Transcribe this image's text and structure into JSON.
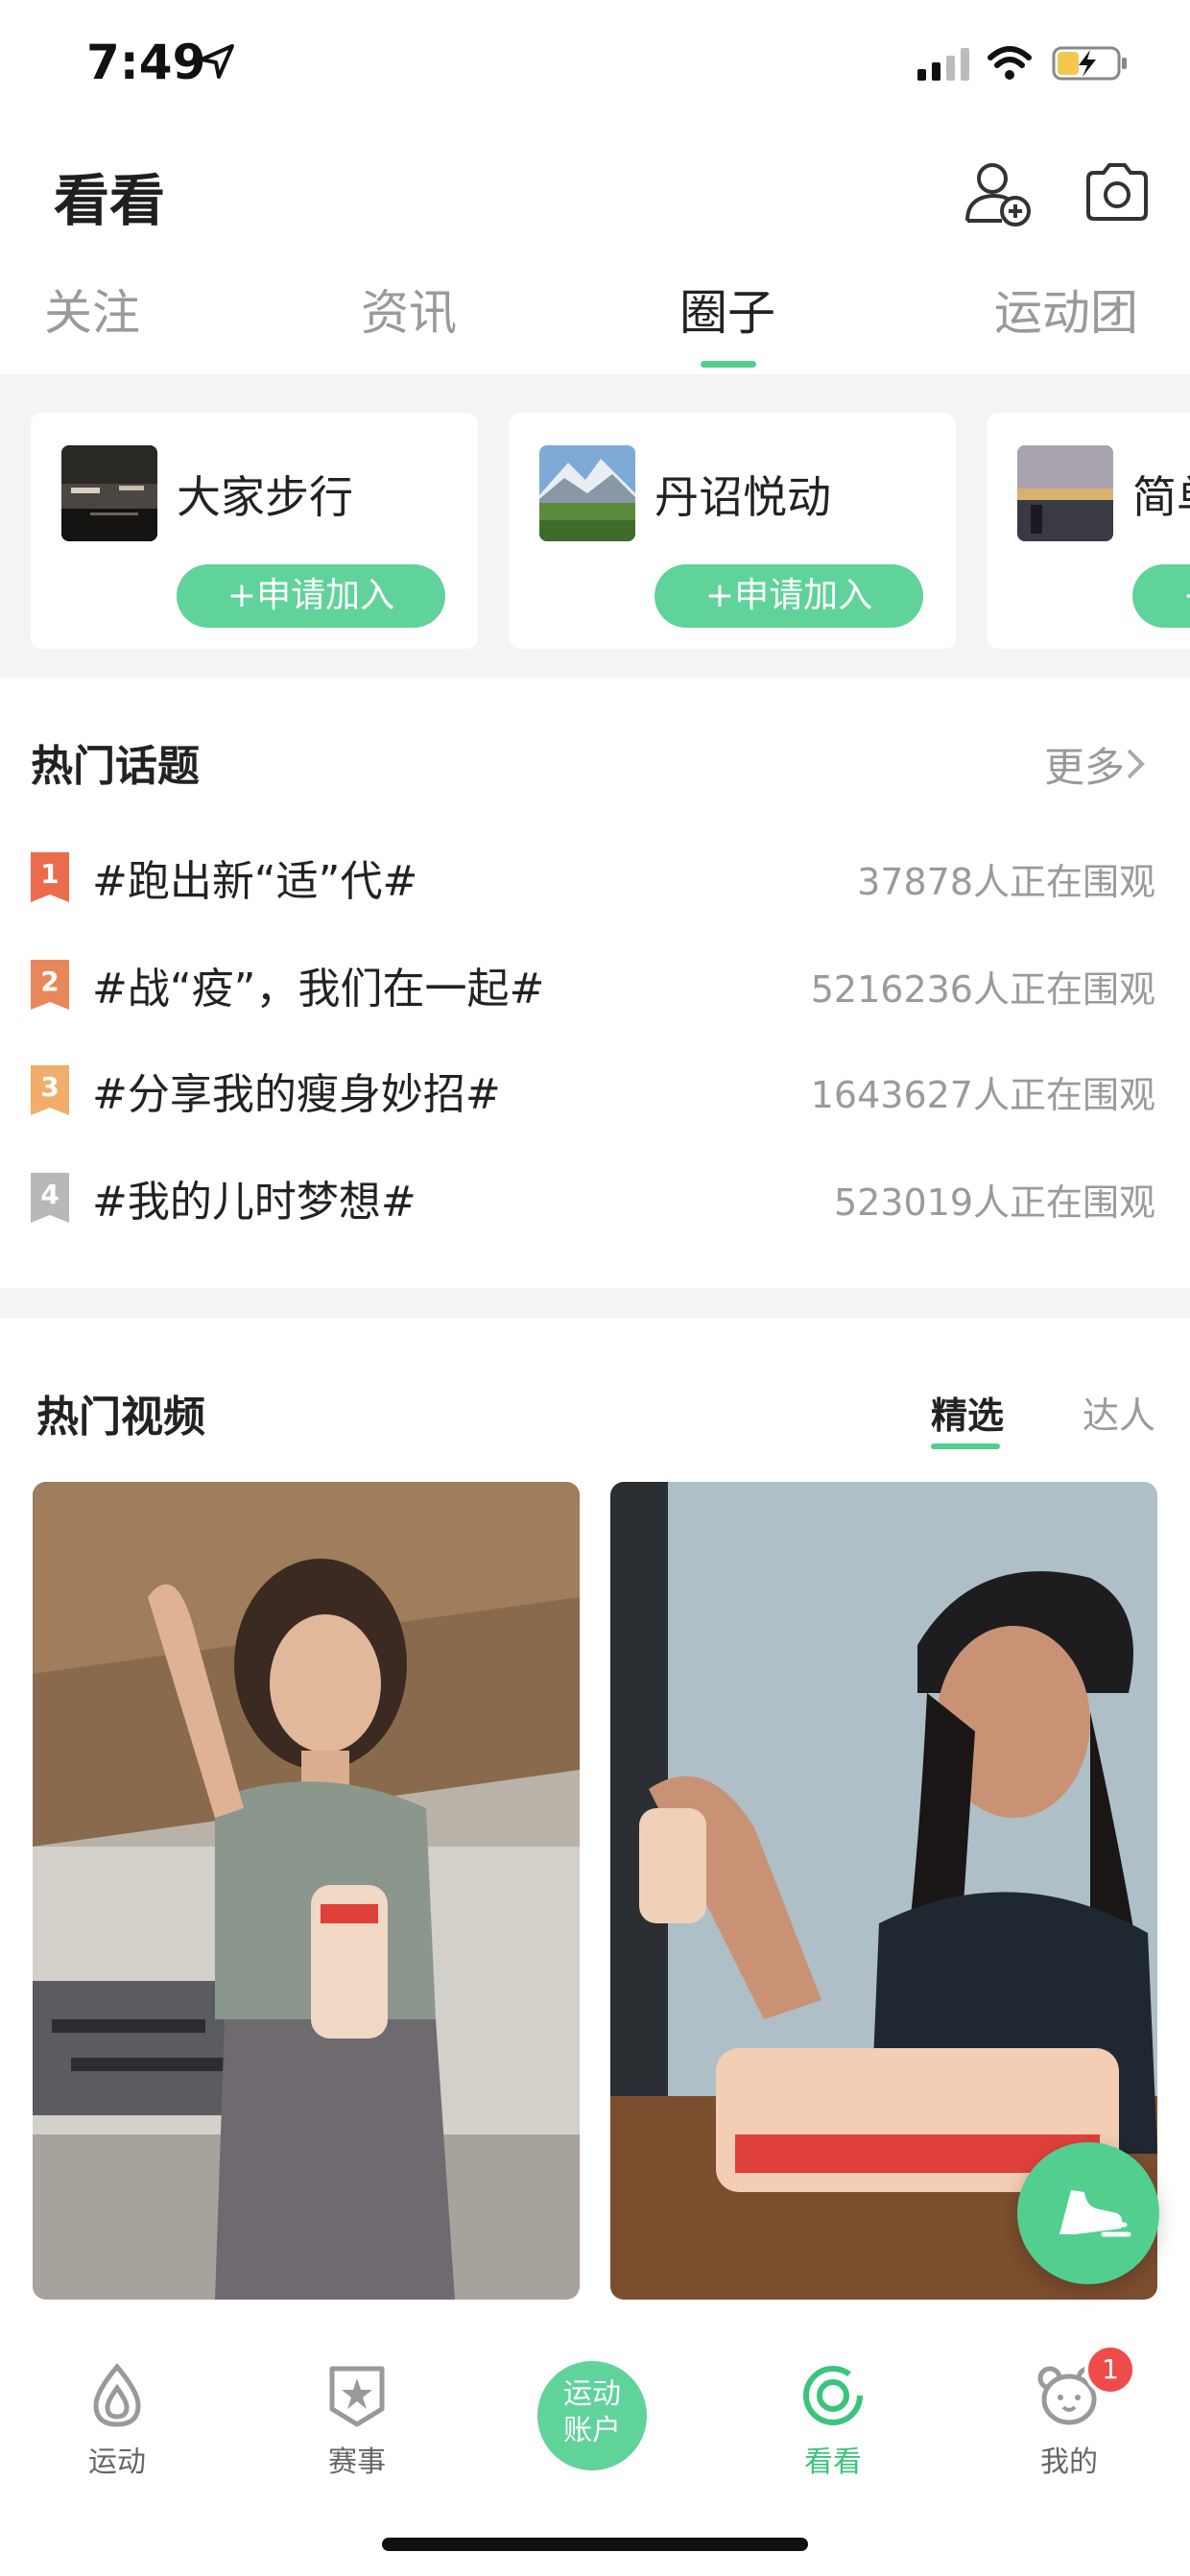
{
  "status_bar": {
    "time": "7:49"
  },
  "header": {
    "title": "看看",
    "tabs": [
      {
        "label": "关注"
      },
      {
        "label": "资讯"
      },
      {
        "label": "圈子"
      },
      {
        "label": "运动团"
      }
    ],
    "active_tab": "圈子"
  },
  "circles": [
    {
      "name": "大家步行",
      "join_label": "+申请加入"
    },
    {
      "name": "丹诏悦动",
      "join_label": "+申请加入"
    },
    {
      "name": "简单",
      "join_label": "+申请加入"
    }
  ],
  "hot_topics": {
    "title": "热门话题",
    "more_label": "更多",
    "items": [
      {
        "rank": "1",
        "title": "#跑出新“适”代#",
        "count": "37878人正在围观",
        "color": "#ec6b4c"
      },
      {
        "rank": "2",
        "title": "#战“疫”，我们在一起#",
        "count": "5216236人正在围观",
        "color": "#e8875a"
      },
      {
        "rank": "3",
        "title": "#分享我的瘦身妙招#",
        "count": "1643627人正在围观",
        "color": "#f2ad6a"
      },
      {
        "rank": "4",
        "title": "#我的儿时梦想#",
        "count": "523019人正在围观",
        "color": "#b8b8b8"
      }
    ]
  },
  "hot_videos": {
    "title": "热门视频",
    "tabs": [
      {
        "label": "精选"
      },
      {
        "label": "达人"
      }
    ]
  },
  "tabbar": {
    "items": [
      {
        "label": "运动",
        "icon": "drop-icon"
      },
      {
        "label": "赛事",
        "icon": "star-shield-icon"
      },
      {
        "label": "运动账户",
        "icon": "center-button"
      },
      {
        "label": "看看",
        "icon": "ring-icon"
      },
      {
        "label": "我的",
        "icon": "bear-face-icon"
      }
    ],
    "center_line1": "运动",
    "center_line2": "账户",
    "notification_count": "1"
  },
  "colors": {
    "accent": "#52cf8f",
    "badge": "#ef4b4b"
  }
}
